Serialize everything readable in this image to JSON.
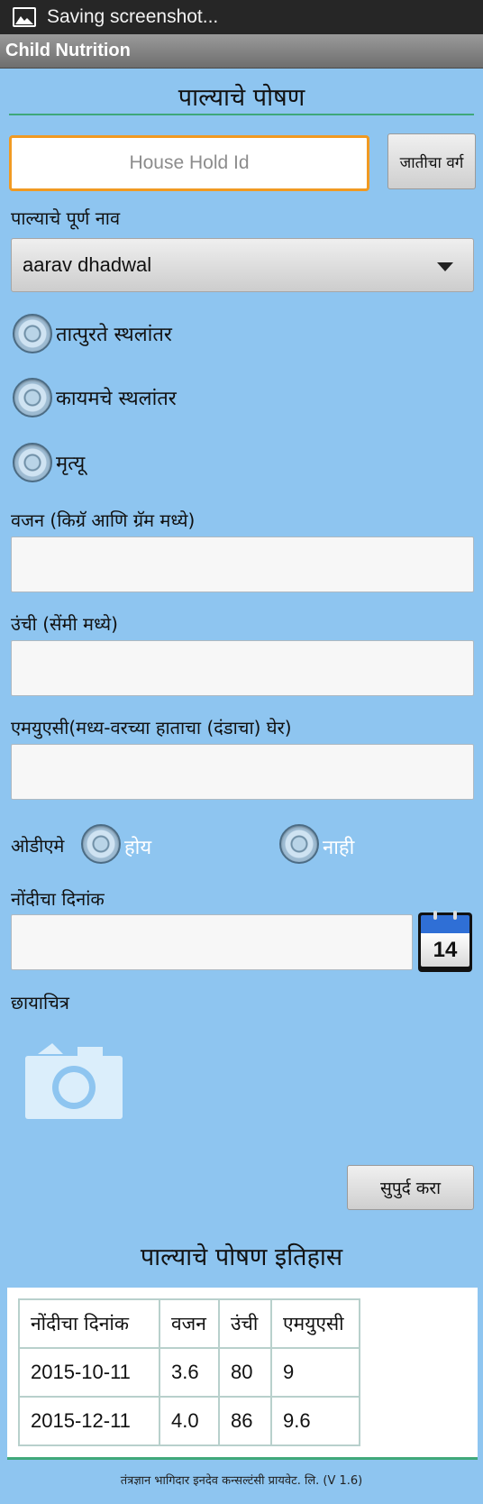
{
  "status_bar": {
    "text": "Saving screenshot...",
    "icon": "image-icon"
  },
  "app_bar": {
    "title": "Child Nutrition"
  },
  "form": {
    "title": "पाल्याचे पोषण",
    "household_id": {
      "placeholder": "House Hold Id",
      "value": ""
    },
    "caste_button_label": "जातीचा वर्ग",
    "child_name_label": "पाल्याचे पूर्ण नाव",
    "child_name_selected": "aarav dhadwal",
    "status_options": [
      "तात्पुरते स्थलांतर",
      "कायमचे स्थलांतर",
      "मृत्यू"
    ],
    "weight_label": "वजन (किग्रॅ आणि ग्रॅम मध्ये)",
    "height_label": "उंची (सेंमी मध्ये)",
    "muac_label": "एमयुएसी(मध्य-वरच्या हाताचा (दंडाचा) घेर)",
    "odema_label": "ओडीएमे",
    "odema_yes": "होय",
    "odema_no": "नाही",
    "record_date_label": "नोंदीचा दिनांक",
    "calendar_day": "14",
    "photo_label": "छायाचित्र",
    "submit_label": "सुपुर्द करा"
  },
  "history": {
    "title": "पाल्याचे पोषण इतिहास",
    "columns": [
      "नोंदीचा दिनांक",
      "वजन",
      "उंची",
      "एमयुएसी"
    ],
    "rows": [
      [
        "2015-10-11",
        "3.6",
        "80",
        "9"
      ],
      [
        "2015-12-11",
        "4.0",
        "86",
        "9.6"
      ]
    ]
  },
  "footer": {
    "text": "तंत्रज्ञान भागिदार इनदेव कन्सल्टंसी प्रायवेट. लि. (V 1.6)"
  },
  "colors": {
    "background": "#8ec5f0",
    "accent_rule": "#3fa87a",
    "focus_border": "#f19a22"
  }
}
